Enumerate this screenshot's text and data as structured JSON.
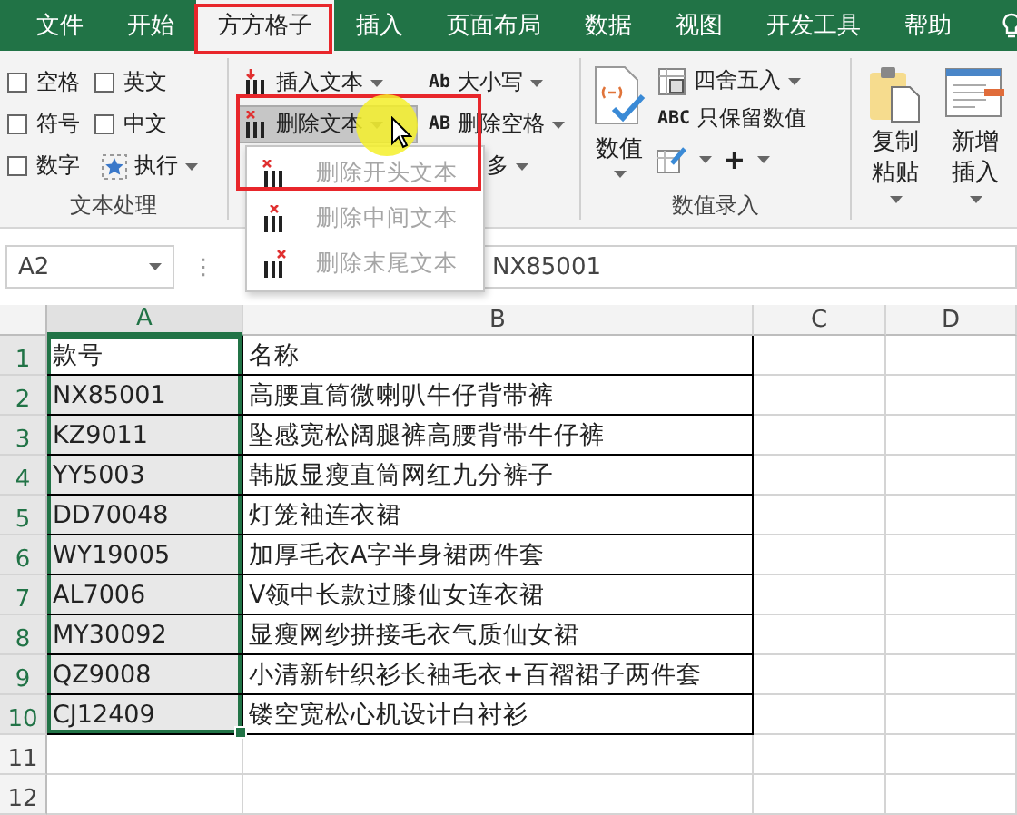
{
  "tabs": [
    {
      "label": "文件",
      "selected": false
    },
    {
      "label": "开始",
      "selected": false
    },
    {
      "label": "方方格子",
      "selected": true
    },
    {
      "label": "插入",
      "selected": false
    },
    {
      "label": "页面布局",
      "selected": false
    },
    {
      "label": "数据",
      "selected": false
    },
    {
      "label": "视图",
      "selected": false
    },
    {
      "label": "开发工具",
      "selected": false
    },
    {
      "label": "帮助",
      "selected": false
    }
  ],
  "text_group": {
    "checkboxes": [
      {
        "label": "空格",
        "checked": false
      },
      {
        "label": "英文",
        "checked": false
      },
      {
        "label": "符号",
        "checked": false
      },
      {
        "label": "中文",
        "checked": false
      },
      {
        "label": "数字",
        "checked": false
      }
    ],
    "execute": "执行",
    "label": "文本处理"
  },
  "edit_group": {
    "buttons": [
      {
        "kind": "insert",
        "label": "插入文本",
        "pressed": false
      },
      {
        "kind": "case",
        "prefix": "Ab",
        "label": "大小写",
        "pressed": false
      },
      {
        "kind": "delete",
        "label": "删除文本",
        "pressed": true
      },
      {
        "kind": "case",
        "prefix": "AB",
        "label": "删除空格",
        "pressed": false
      },
      {
        "kind": "plain",
        "label": "多",
        "pressed": false
      }
    ]
  },
  "number_group": {
    "big_button": "数值",
    "buttons": [
      {
        "kind": "round",
        "label": "四舍五入"
      },
      {
        "kind": "case",
        "prefix": "ABC",
        "label": "只保留数值"
      }
    ],
    "plus": "+",
    "label": "数值录入"
  },
  "clipboard_group": {
    "buttons": [
      {
        "kind": "clipboard",
        "label": "复制粘贴"
      },
      {
        "kind": "form",
        "label": "新增插入"
      }
    ]
  },
  "menu": {
    "items": [
      {
        "kind": "start",
        "label": "删除开头文本",
        "disabled": true
      },
      {
        "kind": "middle",
        "label": "删除中间文本",
        "disabled": true
      },
      {
        "kind": "end",
        "label": "删除末尾文本",
        "disabled": true
      }
    ]
  },
  "formula_bar": {
    "name_box": "A2",
    "dots": "⋮",
    "value": "NX85001"
  },
  "columns": [
    {
      "label": "A",
      "selected": true
    },
    {
      "label": "B",
      "selected": false
    },
    {
      "label": "C",
      "selected": false
    },
    {
      "label": "D",
      "selected": false
    }
  ],
  "rows": [
    {
      "number": "1",
      "selected": true,
      "active": true,
      "a": "款号",
      "b": "名称"
    },
    {
      "number": "2",
      "selected": true,
      "active": false,
      "a": "NX85001",
      "b": "高腰直筒微喇叭牛仔背带裤"
    },
    {
      "number": "3",
      "selected": true,
      "active": false,
      "a": "KZ9011",
      "b": "坠感宽松阔腿裤高腰背带牛仔裤"
    },
    {
      "number": "4",
      "selected": true,
      "active": false,
      "a": "YY5003",
      "b": "韩版显瘦直筒网红九分裤子"
    },
    {
      "number": "5",
      "selected": true,
      "active": false,
      "a": "DD70048",
      "b": "灯笼袖连衣裙"
    },
    {
      "number": "6",
      "selected": true,
      "active": false,
      "a": "WY19005",
      "b": "加厚毛衣A字半身裙两件套"
    },
    {
      "number": "7",
      "selected": true,
      "active": false,
      "a": "AL7006",
      "b": "V领中长款过膝仙女连衣裙"
    },
    {
      "number": "8",
      "selected": true,
      "active": false,
      "a": "MY30092",
      "b": "显瘦网纱拼接毛衣气质仙女裙"
    },
    {
      "number": "9",
      "selected": true,
      "active": false,
      "a": "QZ9008",
      "b": "小清新针织衫长袖毛衣+百褶裙子两件套"
    },
    {
      "number": "10",
      "selected": true,
      "active": false,
      "a": "CJ12409",
      "b": "镂空宽松心机设计白衬衫"
    },
    {
      "number": "11",
      "selected": false
    },
    {
      "number": "12",
      "selected": false
    }
  ]
}
